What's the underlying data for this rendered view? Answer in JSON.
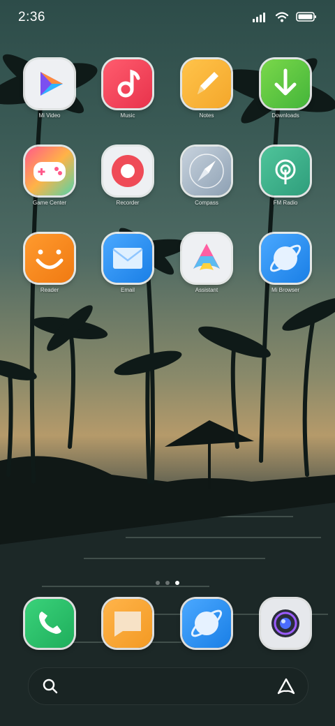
{
  "status": {
    "time": "2:36"
  },
  "apps": [
    {
      "label": "Mi Video"
    },
    {
      "label": "Music"
    },
    {
      "label": "Notes"
    },
    {
      "label": "Downloads"
    },
    {
      "label": "Game Center"
    },
    {
      "label": "Recorder"
    },
    {
      "label": "Compass"
    },
    {
      "label": "FM Radio"
    },
    {
      "label": "Reader"
    },
    {
      "label": "Email"
    },
    {
      "label": "Assistant"
    },
    {
      "label": "Mi Browser"
    }
  ],
  "dock": [
    "phone",
    "messages",
    "mi-browser",
    "camera"
  ],
  "page_indicator": {
    "pages": 3,
    "current": 3
  },
  "icons": {
    "status": [
      "signal-icon",
      "wifi-icon",
      "battery-icon"
    ],
    "search": "search-icon",
    "assistant": "assistant-icon"
  }
}
